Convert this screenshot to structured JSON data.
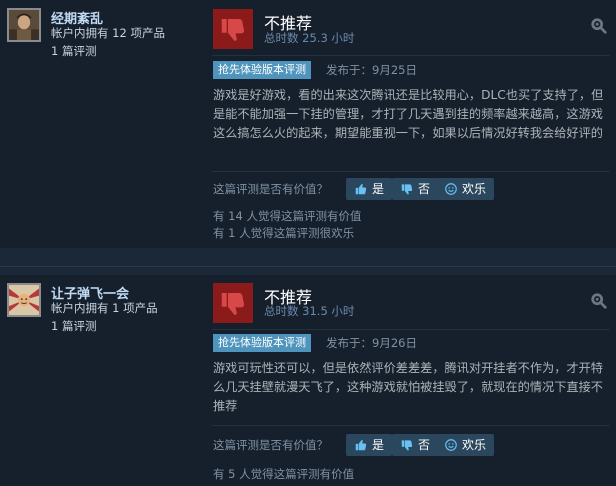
{
  "reviews": [
    {
      "username": "经期紊乱",
      "products_owned": "帐户内拥有 12 项产品",
      "review_count": "1 篇评测",
      "verdict": "不推荐",
      "hours": "总时数 25.3 小时",
      "badge": "抢先体验版本评测",
      "posted": "发布于：9月25日",
      "body": "游戏是好游戏，看的出来这次腾讯还是比较用心，DLC也买了支持了，但是能不能加强一下挂的管理，才打了几天遇到挂的频率越来越高，这游戏这么搞怎么火的起来，期望能重视一下，如果以后情况好转我会给好评的",
      "helpful_question": "这篇评测是否有价值？",
      "buttons": {
        "yes": "是",
        "no": "否",
        "funny": "欢乐"
      },
      "stats": [
        "有 14 人觉得这篇评测有价值",
        "有 1 人觉得这篇评测很欢乐"
      ]
    },
    {
      "username": "让子弹飞一会",
      "products_owned": "帐户内拥有 1 项产品",
      "review_count": "1 篇评测",
      "verdict": "不推荐",
      "hours": "总时数 31.5 小时",
      "badge": "抢先体验版本评测",
      "posted": "发布于：9月26日",
      "body": "游戏可玩性还可以，但是依然评价差差差，腾讯对开挂者不作为，才开特么几天挂壁就漫天飞了，这种游戏就怕被挂毁了，就现在的情况下直接不推荐",
      "helpful_question": "这篇评测是否有价值？",
      "buttons": {
        "yes": "是",
        "no": "否",
        "funny": "欢乐"
      },
      "stats": [
        "有 5 人觉得这篇评测有价值"
      ]
    }
  ],
  "colors": {
    "thumb_down_bg": "#8b1a1a",
    "badge_bg": "#4f94bc",
    "button_bg": "#2a475e",
    "username": "#c1dbf4"
  },
  "icons": {
    "verdict": "thumbs-down-icon",
    "yes": "thumbs-up-icon",
    "no": "thumbs-down-icon",
    "funny": "smiley-icon",
    "award": "award-gear-icon"
  }
}
